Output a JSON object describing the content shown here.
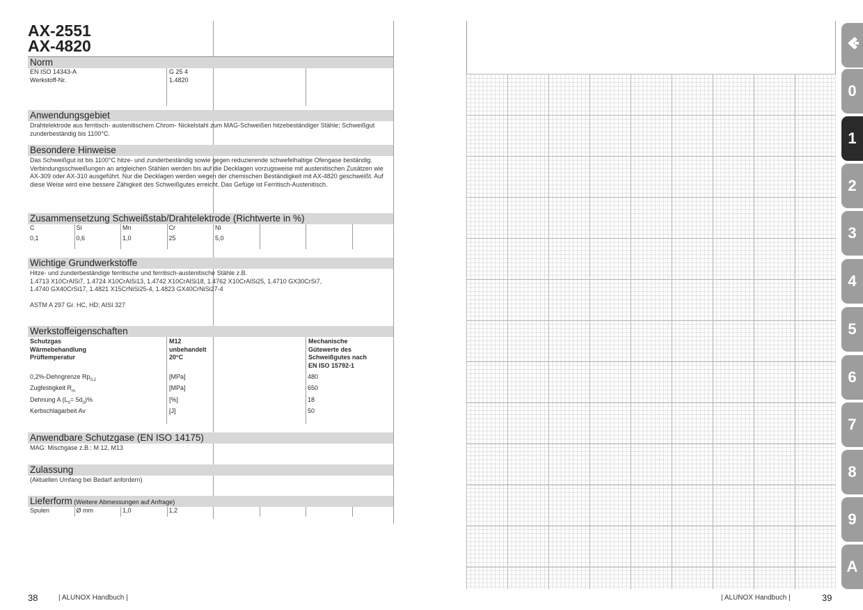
{
  "left_page": {
    "title_line1": "AX-2551",
    "title_line2": "AX-4820",
    "norm": {
      "heading": "Norm",
      "rows": [
        {
          "label": "EN ISO 14343-A",
          "value": "G 25 4"
        },
        {
          "label": "Werkstoff-Nr.",
          "value": "1.4820"
        }
      ]
    },
    "anwendungsgebiet": {
      "heading": "Anwendungsgebiet",
      "text": "Drahtelektrode aus ferritisch- austenitischem Chrom- Nickelstahl zum MAG-Schweißen hitzebeständiger Stähle; Schweißgut zunderbeständig bis 1100°C."
    },
    "hinweise": {
      "heading": "Besondere Hinweise",
      "text": "Das Schweißgut ist bis 1100°C hitze- und zunderbeständig sowie gegen reduzierende schwefelhaltige Ofengase beständig. Verbindungsschweißungen an artgleichen Stählen werden bis auf die Decklagen vorzugsweise mit austenitischen Zusätzen wie AX-309 oder AX-310 ausgeführt. Nur die Decklagen werden wegen der chemischen Beständigkeit mit AX-4820 geschweißt. Auf diese Weise wird eine bessere Zähigkeit des Schweißgutes erreicht. Das Gefüge ist Ferritisch-Austenitisch."
    },
    "zusammensetzung": {
      "heading": "Zusammensetzung Schweißstab/Drahtelektrode (Richtwerte in %)",
      "elements": [
        "C",
        "Si",
        "Mn",
        "Cr",
        "Ni"
      ],
      "values": [
        "0,1",
        "0,6",
        "1,0",
        "25",
        "5,0"
      ]
    },
    "grundwerkstoffe": {
      "heading": "Wichtige Grundwerkstoffe",
      "line1": "Hitze- und zunderbeständige ferritische und ferritisch-austenitische Stähle z.B.",
      "line2": "1.4713 X10CrAlSi7, 1.4724 X10CrAlSi13, 1.4742 X10CrAlSi18, 1.4762 X10CrAlSi25, 1.4710 GX30CrSi7,",
      "line3": "1.4740 GX40CrSi17, 1.4821 X15CrNiSi25-4, 1.4823 GX40CrNiSi27-4",
      "line4": "ASTM A 297 Gr. HC, HD; AISI 327"
    },
    "werkstoff": {
      "heading": "Werkstoffeigenschaften",
      "h_labels": [
        "Schutzgas",
        "Wärmebehandlung",
        "Prüftemperatur"
      ],
      "h_values": [
        "M12",
        "unbehandelt",
        "20°C"
      ],
      "h_right": [
        "Mechanische",
        "Gütewerte des",
        "Schweißgutes nach",
        "EN ISO 15792-1"
      ],
      "rows": [
        {
          "label": "0,2%-Dehngrenze Rp",
          "sub": "0,2",
          "unit": "[MPa]",
          "value": "480"
        },
        {
          "label": "Zugfestigkeit R",
          "sub": "m",
          "unit": "[MPa]",
          "value": "650"
        },
        {
          "label": "Dehnung A (L",
          "sub": "0",
          "label2": "= 5d",
          "sub2": "0",
          "label3": ")%",
          "unit": "[%]",
          "value": "18"
        },
        {
          "label": "Kerbschlagarbeit Av",
          "unit": "[J]",
          "value": "50"
        }
      ]
    },
    "schutzgase": {
      "heading": "Anwendbare Schutzgase (EN ISO 14175)",
      "text": "MAG: Mischgase z.B.: M 12, M13"
    },
    "zulassung": {
      "heading": "Zulassung",
      "text": "(Aktuellen Umfang bei Bedarf anfordern)"
    },
    "lieferform": {
      "heading": "Lieferform",
      "heading_small": " (Weitere Abmessungen auf Anfrage)",
      "cells": [
        "Spulen",
        "Ø  mm",
        "1,0",
        "1,2"
      ]
    },
    "footer": {
      "page": "38",
      "text": "| ALUNOX Handbuch |"
    }
  },
  "right_page": {
    "footer": {
      "page": "39",
      "text": "| ALUNOX Handbuch |"
    }
  },
  "tabs": [
    {
      "label": "",
      "icon": "alunox-logo-icon",
      "active": false
    },
    {
      "label": "0",
      "active": false
    },
    {
      "label": "1",
      "active": true
    },
    {
      "label": "2",
      "active": false
    },
    {
      "label": "3",
      "active": false
    },
    {
      "label": "4",
      "active": false
    },
    {
      "label": "5",
      "active": false
    },
    {
      "label": "6",
      "active": false
    },
    {
      "label": "7",
      "active": false
    },
    {
      "label": "8",
      "active": false
    },
    {
      "label": "9",
      "active": false
    },
    {
      "label": "A",
      "active": false
    }
  ],
  "colors": {
    "tab_inactive": "#9d9d9d",
    "tab_active": "#2a2a2a",
    "section_header": "#d7d7d7"
  }
}
